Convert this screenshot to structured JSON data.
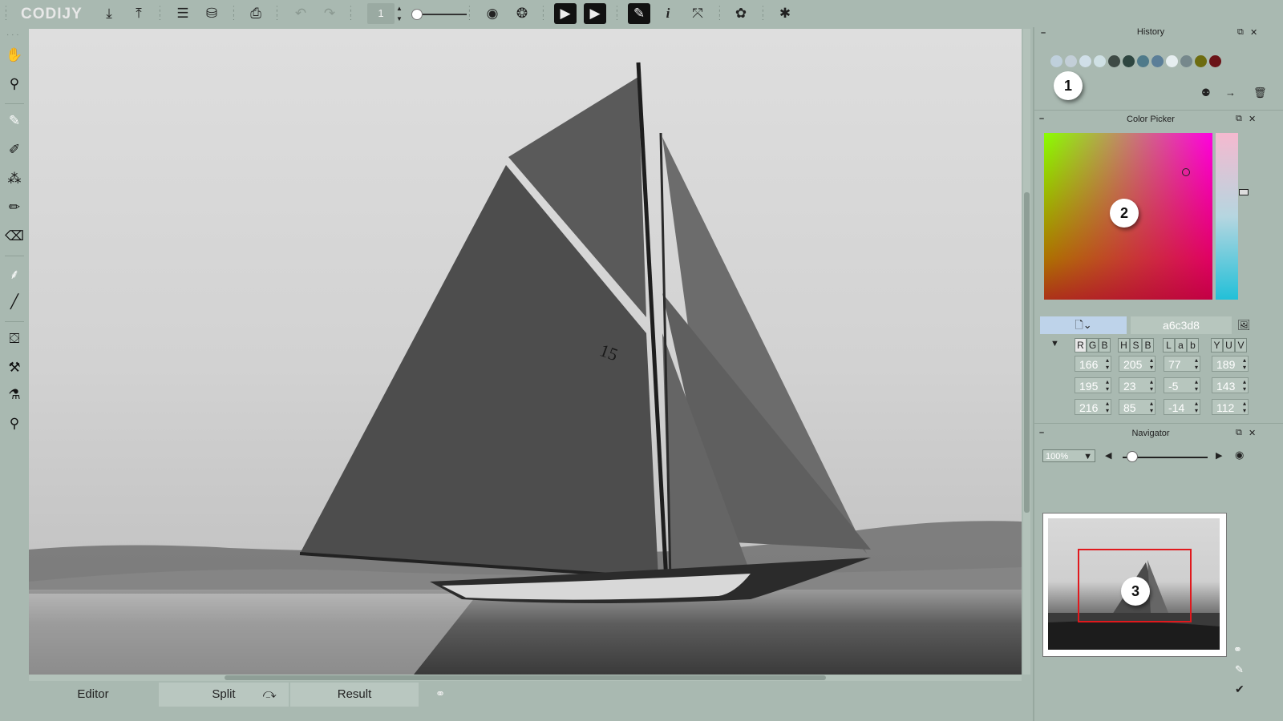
{
  "app": {
    "logo": "CODIJY"
  },
  "toolbar": {
    "brush_size": "1",
    "buttons": [
      "import",
      "export",
      "layers",
      "save-project",
      "print",
      "undo",
      "redo",
      "brush-size",
      "preview",
      "toggle-colorization",
      "play-compare",
      "run-colorize",
      "tips",
      "info",
      "fullscreen",
      "settings",
      "debug"
    ]
  },
  "left_tools": [
    "hand",
    "zoom",
    "color-pencil",
    "fill-pencil",
    "pattern-brush",
    "pencil",
    "eraser",
    "recolor",
    "line",
    "paint-bucket",
    "hammer",
    "dropper-brush",
    "eyedropper"
  ],
  "bottom_tabs": {
    "editor": "Editor",
    "split": "Split",
    "result": "Result"
  },
  "history": {
    "title": "History",
    "badge": "1",
    "swatches": [
      "#bfd0dc",
      "#c3cfd8",
      "#d0dfe8",
      "#cfe0e4",
      "#3e4a45",
      "#2e4640",
      "#4f7a8a",
      "#5b7e98",
      "#e6eef0",
      "#76888c",
      "#6d6c10",
      "#6b1418"
    ]
  },
  "color_picker": {
    "title": "Color Picker",
    "badge": "2",
    "hex": "a6c3d8",
    "modes": {
      "rgb": [
        "R",
        "G",
        "B"
      ],
      "hsb": [
        "H",
        "S",
        "B"
      ],
      "lab": [
        "L",
        "a",
        "b"
      ],
      "yuv": [
        "Y",
        "U",
        "V"
      ]
    },
    "values": {
      "r": "166",
      "g": "195",
      "b": "216",
      "h": "205",
      "s": "23",
      "br": "85",
      "l": "77",
      "a": "-5",
      "lb": "-14",
      "y": "189",
      "u": "143",
      "v": "112"
    }
  },
  "navigator": {
    "title": "Navigator",
    "zoom": "100%",
    "badge": "3"
  },
  "image": {
    "sail_number": "15"
  }
}
